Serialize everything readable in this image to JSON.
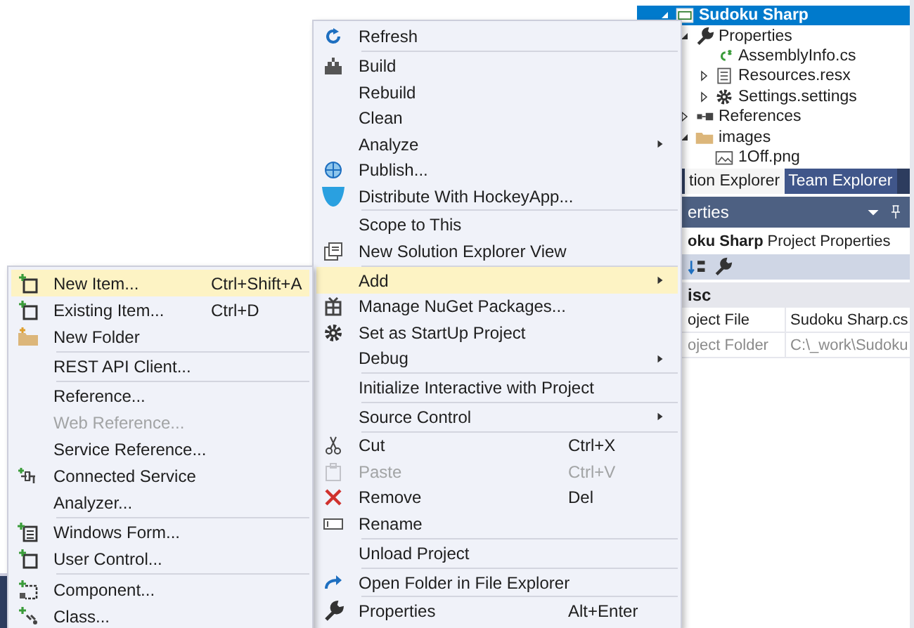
{
  "solution_tree": [
    {
      "label": "Sudoku Sharp",
      "selected": true,
      "expanded": true,
      "children": [
        {
          "label": "Properties",
          "selected": false,
          "expanded": true,
          "children": [
            {
              "label": "AssemblyInfo.cs",
              "selected": false
            },
            {
              "label": "Resources.resx",
              "selected": false,
              "expanded": false
            },
            {
              "label": "Settings.settings",
              "selected": false,
              "expanded": false
            }
          ]
        },
        {
          "label": "References",
          "selected": false,
          "expanded": false
        },
        {
          "label": "images",
          "selected": false,
          "expanded": true,
          "children": [
            {
              "label": "1Off.png",
              "selected": false
            }
          ]
        }
      ]
    }
  ],
  "tabs": [
    {
      "label": "tion Explorer",
      "selected": true
    },
    {
      "label": "Team Explorer",
      "selected": false
    }
  ],
  "properties_panel": {
    "title": "erties",
    "object_name": "oku Sharp",
    "object_type": "Project Properties",
    "category": "isc",
    "rows": [
      {
        "name": "oject File",
        "value": "Sudoku Sharp.cs",
        "disabled": false
      },
      {
        "name": "oject Folder",
        "value": "C:\\_work\\Sudoku",
        "disabled": true
      }
    ]
  },
  "context_menu": [
    {
      "kind": "item",
      "label": "Refresh",
      "selected": false,
      "disabled": false
    },
    {
      "kind": "separator"
    },
    {
      "kind": "item",
      "label": "Build",
      "selected": false,
      "disabled": false
    },
    {
      "kind": "item",
      "label": "Rebuild",
      "selected": false,
      "disabled": false
    },
    {
      "kind": "item",
      "label": "Clean",
      "selected": false,
      "disabled": false
    },
    {
      "kind": "submenu",
      "label": "Analyze",
      "selected": false,
      "disabled": false
    },
    {
      "kind": "item",
      "label": "Publish...",
      "selected": false,
      "disabled": false
    },
    {
      "kind": "item",
      "label": "Distribute With HockeyApp...",
      "selected": false,
      "disabled": false
    },
    {
      "kind": "separator"
    },
    {
      "kind": "item",
      "label": "Scope to This",
      "selected": false,
      "disabled": false
    },
    {
      "kind": "item",
      "label": "New Solution Explorer View",
      "selected": false,
      "disabled": false
    },
    {
      "kind": "separator"
    },
    {
      "kind": "submenu",
      "label": "Add",
      "selected": true,
      "disabled": false
    },
    {
      "kind": "item",
      "label": "Manage NuGet Packages...",
      "selected": false,
      "disabled": false
    },
    {
      "kind": "item",
      "label": "Set as StartUp Project",
      "selected": false,
      "disabled": false
    },
    {
      "kind": "submenu",
      "label": "Debug",
      "selected": false,
      "disabled": false
    },
    {
      "kind": "separator"
    },
    {
      "kind": "item",
      "label": "Initialize Interactive with Project",
      "selected": false,
      "disabled": false
    },
    {
      "kind": "separator"
    },
    {
      "kind": "submenu",
      "label": "Source Control",
      "selected": false,
      "disabled": false
    },
    {
      "kind": "separator"
    },
    {
      "kind": "item",
      "label": "Cut",
      "shortcut": "Ctrl+X",
      "selected": false,
      "disabled": false
    },
    {
      "kind": "item",
      "label": "Paste",
      "shortcut": "Ctrl+V",
      "selected": false,
      "disabled": true
    },
    {
      "kind": "item",
      "label": "Remove",
      "shortcut": "Del",
      "selected": false,
      "disabled": false
    },
    {
      "kind": "item",
      "label": "Rename",
      "selected": false,
      "disabled": false
    },
    {
      "kind": "separator"
    },
    {
      "kind": "item",
      "label": "Unload Project",
      "selected": false,
      "disabled": false
    },
    {
      "kind": "separator"
    },
    {
      "kind": "item",
      "label": "Open Folder in File Explorer",
      "selected": false,
      "disabled": false
    },
    {
      "kind": "separator"
    },
    {
      "kind": "item",
      "label": "Properties",
      "shortcut": "Alt+Enter",
      "selected": false,
      "disabled": false
    }
  ],
  "add_submenu": [
    {
      "kind": "item",
      "label": "New Item...",
      "shortcut": "Ctrl+Shift+A",
      "selected": true,
      "disabled": false
    },
    {
      "kind": "item",
      "label": "Existing Item...",
      "shortcut": "Ctrl+D",
      "selected": false,
      "disabled": false
    },
    {
      "kind": "item",
      "label": "New Folder",
      "selected": false,
      "disabled": false
    },
    {
      "kind": "separator"
    },
    {
      "kind": "item",
      "label": "REST API Client...",
      "selected": false,
      "disabled": false
    },
    {
      "kind": "separator"
    },
    {
      "kind": "item",
      "label": "Reference...",
      "selected": false,
      "disabled": false
    },
    {
      "kind": "item",
      "label": "Web Reference...",
      "selected": false,
      "disabled": true
    },
    {
      "kind": "item",
      "label": "Service Reference...",
      "selected": false,
      "disabled": false
    },
    {
      "kind": "item",
      "label": "Connected Service",
      "selected": false,
      "disabled": false
    },
    {
      "kind": "item",
      "label": "Analyzer...",
      "selected": false,
      "disabled": false
    },
    {
      "kind": "separator"
    },
    {
      "kind": "item",
      "label": "Windows Form...",
      "selected": false,
      "disabled": false
    },
    {
      "kind": "item",
      "label": "User Control...",
      "selected": false,
      "disabled": false
    },
    {
      "kind": "separator"
    },
    {
      "kind": "item",
      "label": "Component...",
      "selected": false,
      "disabled": false
    },
    {
      "kind": "item",
      "label": "Class...",
      "selected": false,
      "disabled": false
    }
  ]
}
